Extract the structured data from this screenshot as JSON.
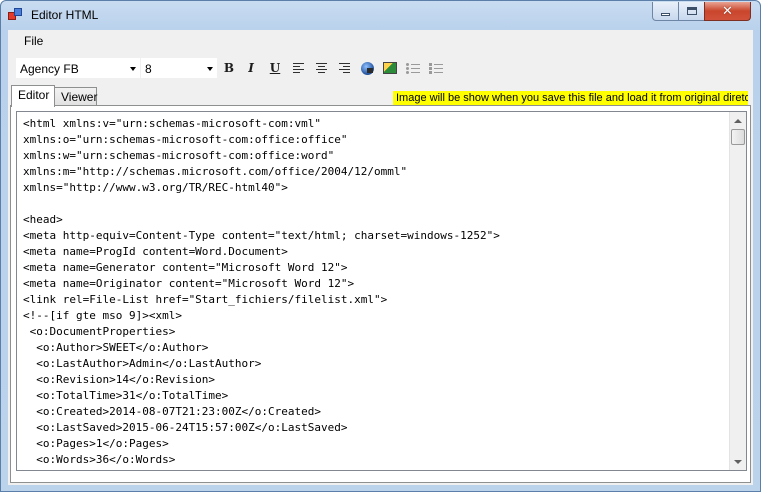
{
  "window": {
    "title": "Editor HTML"
  },
  "menu": {
    "file": "File"
  },
  "toolbar": {
    "font": "Agency FB",
    "size": "8",
    "bold": "B",
    "italic": "I",
    "underline": "U"
  },
  "tabs": [
    {
      "label": "Editor",
      "active": true
    },
    {
      "label": "Viewer",
      "active": false
    }
  ],
  "notice": "Image will be show when you save this file and load it from original diretory",
  "editor": {
    "lines": [
      "<html xmlns:v=\"urn:schemas-microsoft-com:vml\"",
      "xmlns:o=\"urn:schemas-microsoft-com:office:office\"",
      "xmlns:w=\"urn:schemas-microsoft-com:office:word\"",
      "xmlns:m=\"http://schemas.microsoft.com/office/2004/12/omml\"",
      "xmlns=\"http://www.w3.org/TR/REC-html40\">",
      "",
      "<head>",
      "<meta http-equiv=Content-Type content=\"text/html; charset=windows-1252\">",
      "<meta name=ProgId content=Word.Document>",
      "<meta name=Generator content=\"Microsoft Word 12\">",
      "<meta name=Originator content=\"Microsoft Word 12\">",
      "<link rel=File-List href=\"Start_fichiers/filelist.xml\">",
      "<!--[if gte mso 9]><xml>",
      " <o:DocumentProperties>",
      "  <o:Author>SWEET</o:Author>",
      "  <o:LastAuthor>Admin</o:LastAuthor>",
      "  <o:Revision>14</o:Revision>",
      "  <o:TotalTime>31</o:TotalTime>",
      "  <o:Created>2014-08-07T21:23:00Z</o:Created>",
      "  <o:LastSaved>2015-06-24T15:57:00Z</o:LastSaved>",
      "  <o:Pages>1</o:Pages>",
      "  <o:Words>36</o:Words>"
    ]
  }
}
